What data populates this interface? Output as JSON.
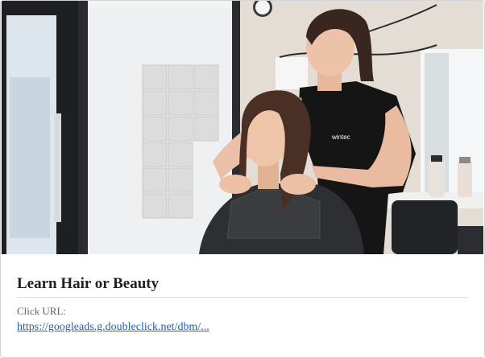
{
  "ad": {
    "headline": "Learn Hair or Beauty",
    "click_label": "Click URL:",
    "click_url": "https://googleads.g.doubleclick.net/dbm/...",
    "image_alt": "Hairdressing student styling a client's hair",
    "shirt_logo": "wintec"
  },
  "colors": {
    "link": "#1a5fb4",
    "headline": "#202124",
    "label": "#5f6368",
    "divider": "#dadce0"
  }
}
